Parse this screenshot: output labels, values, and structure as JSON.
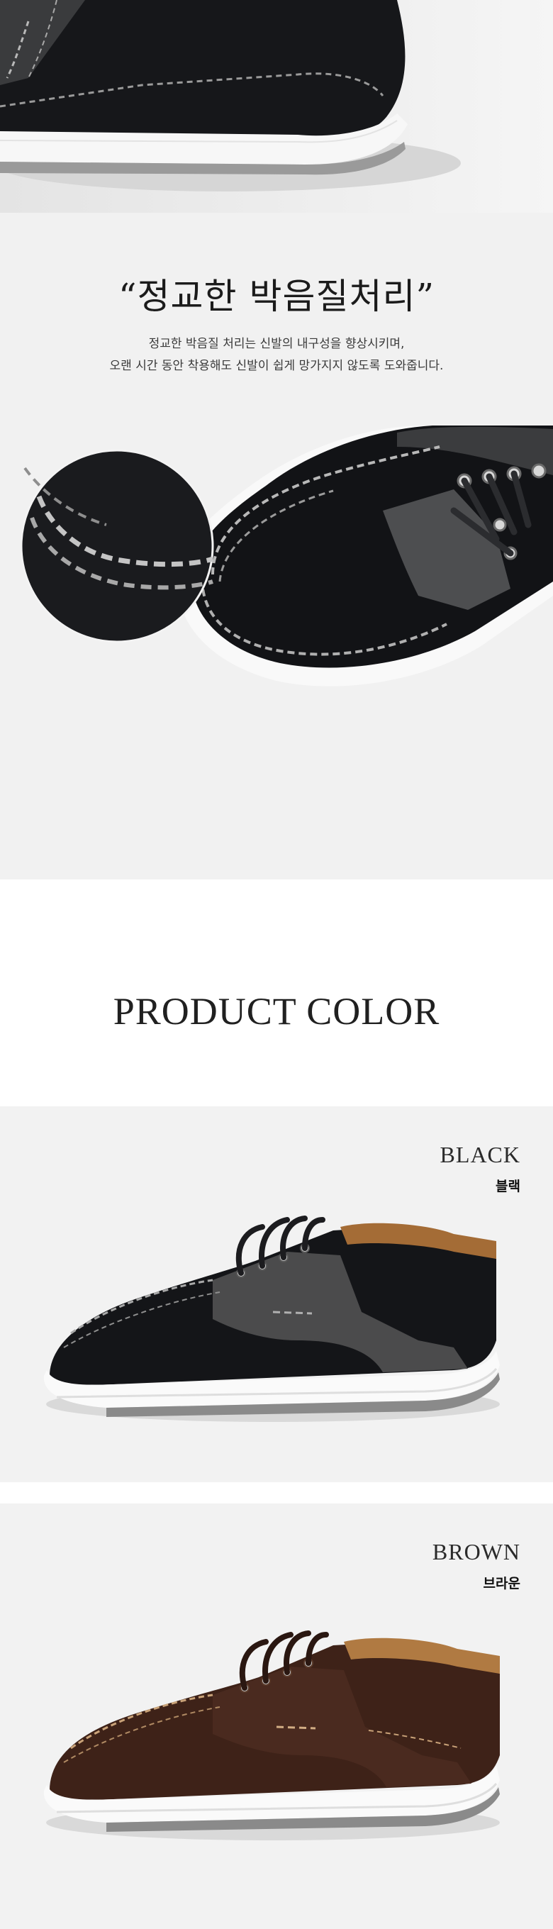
{
  "detail": {
    "title": "“정교한 박음질처리”",
    "desc_line1": "정교한 박음질 처리는 신발의 내구성을 향상시키며,",
    "desc_line2": "오랜 시간 동안 착용해도 신발이 쉽게 망가지지 않도록 도와줍니다."
  },
  "product_color": {
    "heading": "PRODUCT COLOR",
    "colors": [
      {
        "name_en": "BLACK",
        "name_ko": "블랙",
        "upper": "#141518",
        "panel": "#4b4b4c"
      },
      {
        "name_en": "BROWN",
        "name_ko": "브라운",
        "upper": "#3e2218",
        "panel": "#4a2a1f"
      }
    ]
  }
}
